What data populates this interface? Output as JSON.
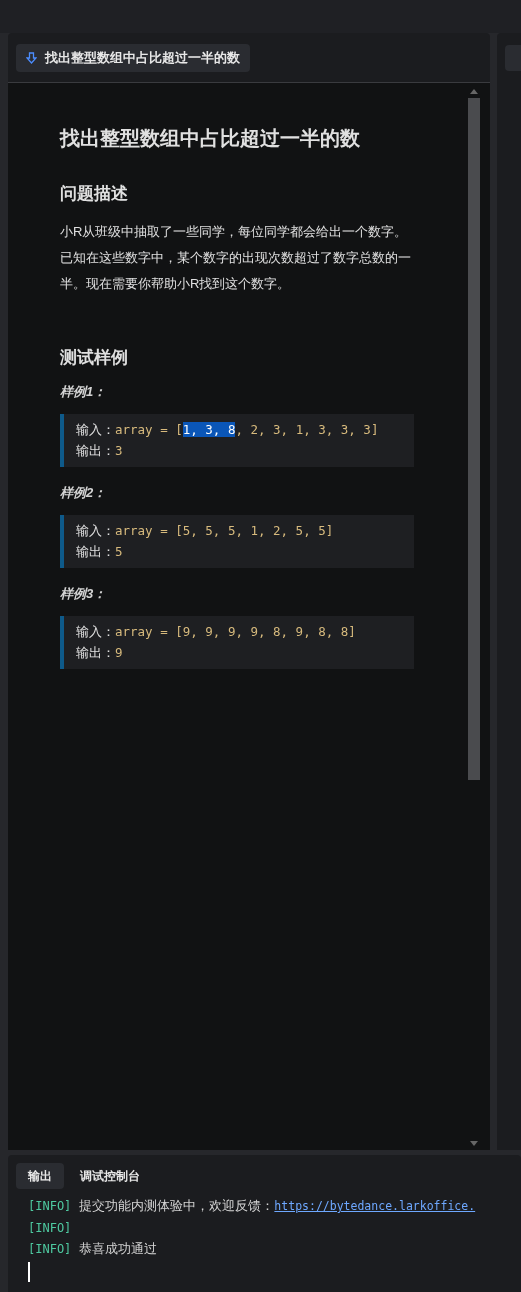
{
  "panel_tab": {
    "label": "找出整型数组中占比超过一半的数"
  },
  "document": {
    "title": "找出整型数组中占比超过一半的数",
    "sections": [
      {
        "heading": "问题描述",
        "paragraph": "小R从班级中抽取了一些同学，每位同学都会给出一个数字。已知在这些数字中，某个数字的出现次数超过了数字总数的一半。现在需要你帮助小R找到这个数字。"
      },
      {
        "heading": "测试样例",
        "examples": [
          {
            "label": "样例1：",
            "input_label": "输入：",
            "input": [
              {
                "text": "array = [",
                "selected": false
              },
              {
                "text": "1, 3, 8",
                "selected": true
              },
              {
                "text": ", 2, 3, 1, 3, 3, 3]",
                "selected": false
              }
            ],
            "output_label": "输出：",
            "output": "3"
          },
          {
            "label": "样例2：",
            "input_label": "输入：",
            "input": [
              {
                "text": "array = [5, 5, 5, 1, 2, 5, 5]",
                "selected": false
              }
            ],
            "output_label": "输出：",
            "output": "5"
          },
          {
            "label": "样例3：",
            "input_label": "输入：",
            "input": [
              {
                "text": "array = [9, 9, 9, 9, 8, 9, 8, 8]",
                "selected": false
              }
            ],
            "output_label": "输出：",
            "output": "9"
          }
        ]
      }
    ]
  },
  "console": {
    "tabs": [
      {
        "label": "输出",
        "selected": true
      },
      {
        "label": "调试控制台",
        "selected": false
      }
    ],
    "lines": [
      {
        "tag": "[INFO]",
        "message": "提交功能内测体验中，欢迎反馈：",
        "link": "https://bytedance.larkoffice."
      },
      {
        "tag": "[INFO]"
      },
      {
        "tag": "[INFO]",
        "message": "恭喜成功通过"
      }
    ]
  }
}
